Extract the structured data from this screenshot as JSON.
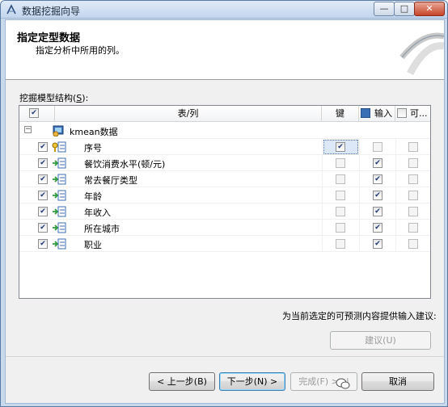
{
  "window": {
    "title": "数据挖掘向导",
    "controls": {
      "minimize": "—",
      "maximize": "□",
      "close": "✕"
    }
  },
  "header": {
    "title": "指定定型数据",
    "subtitle": "指定分析中所用的列。"
  },
  "section_label_prefix": "挖掘模型结构(",
  "section_label_key": "S",
  "section_label_suffix": "):",
  "grid": {
    "columns": {
      "table_col": "表/列",
      "key": "键",
      "input": "输入",
      "predict": "可..."
    },
    "model": {
      "name": "kmean数据",
      "expander": "−"
    },
    "rows": [
      {
        "name": "序号",
        "selected": true,
        "key": true,
        "input": false,
        "predict": false,
        "key_icon": true
      },
      {
        "name": "餐饮消费水平(顿/元)",
        "selected": true,
        "key": false,
        "input": true,
        "predict": false
      },
      {
        "name": "常去餐厅类型",
        "selected": true,
        "key": false,
        "input": true,
        "predict": false
      },
      {
        "name": "年龄",
        "selected": true,
        "key": false,
        "input": true,
        "predict": false
      },
      {
        "name": "年收入",
        "selected": true,
        "key": false,
        "input": true,
        "predict": false
      },
      {
        "name": "所在城市",
        "selected": true,
        "key": false,
        "input": true,
        "predict": false
      },
      {
        "name": "职业",
        "selected": true,
        "key": false,
        "input": true,
        "predict": false
      }
    ]
  },
  "hint": "为当前选定的可预测内容提供输入建议:",
  "buttons": {
    "suggest": "建议(U)",
    "back": "< 上一步(B)",
    "next": "下一步(N) >",
    "finish": "完成(F) >>|",
    "cancel": "取消"
  },
  "watermark": "拓端数据部落",
  "colors": {
    "title_bar": "#c3d6ee",
    "accent": "#3c7fb1",
    "check": "#1f3a75"
  }
}
